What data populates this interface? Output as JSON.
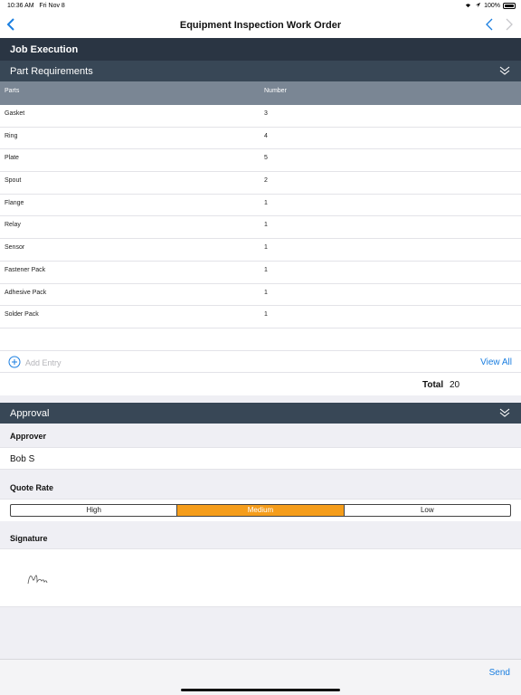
{
  "status_bar": {
    "time": "10:36 AM",
    "date": "Fri Nov 8",
    "battery": "100%"
  },
  "nav": {
    "title": "Equipment Inspection Work Order"
  },
  "job_section": {
    "title": "Job Execution"
  },
  "parts_section": {
    "title": "Part Requirements",
    "columns": {
      "parts": "Parts",
      "number": "Number"
    },
    "rows": [
      {
        "part": "Gasket",
        "number": "3"
      },
      {
        "part": "Ring",
        "number": "4"
      },
      {
        "part": "Plate",
        "number": "5"
      },
      {
        "part": "Spout",
        "number": "2"
      },
      {
        "part": "Flange",
        "number": "1"
      },
      {
        "part": "Relay",
        "number": "1"
      },
      {
        "part": "Sensor",
        "number": "1"
      },
      {
        "part": "Fastener Pack",
        "number": "1"
      },
      {
        "part": "Adhesive Pack",
        "number": "1"
      },
      {
        "part": "Solder Pack",
        "number": "1"
      }
    ],
    "add_entry": "Add Entry",
    "view_all": "View All",
    "total_label": "Total",
    "total_value": "20"
  },
  "approval_section": {
    "title": "Approval",
    "approver_label": "Approver",
    "approver_value": "Bob S",
    "quote_rate_label": "Quote Rate",
    "quote_options": [
      "High",
      "Medium",
      "Low"
    ],
    "quote_selected": "Medium",
    "signature_label": "Signature"
  },
  "bottom_bar": {
    "send": "Send"
  },
  "colors": {
    "accent": "#1a7ee0",
    "header_dark": "#2a3543",
    "header_mid": "#384756",
    "selected_segment": "#f59d1b"
  }
}
